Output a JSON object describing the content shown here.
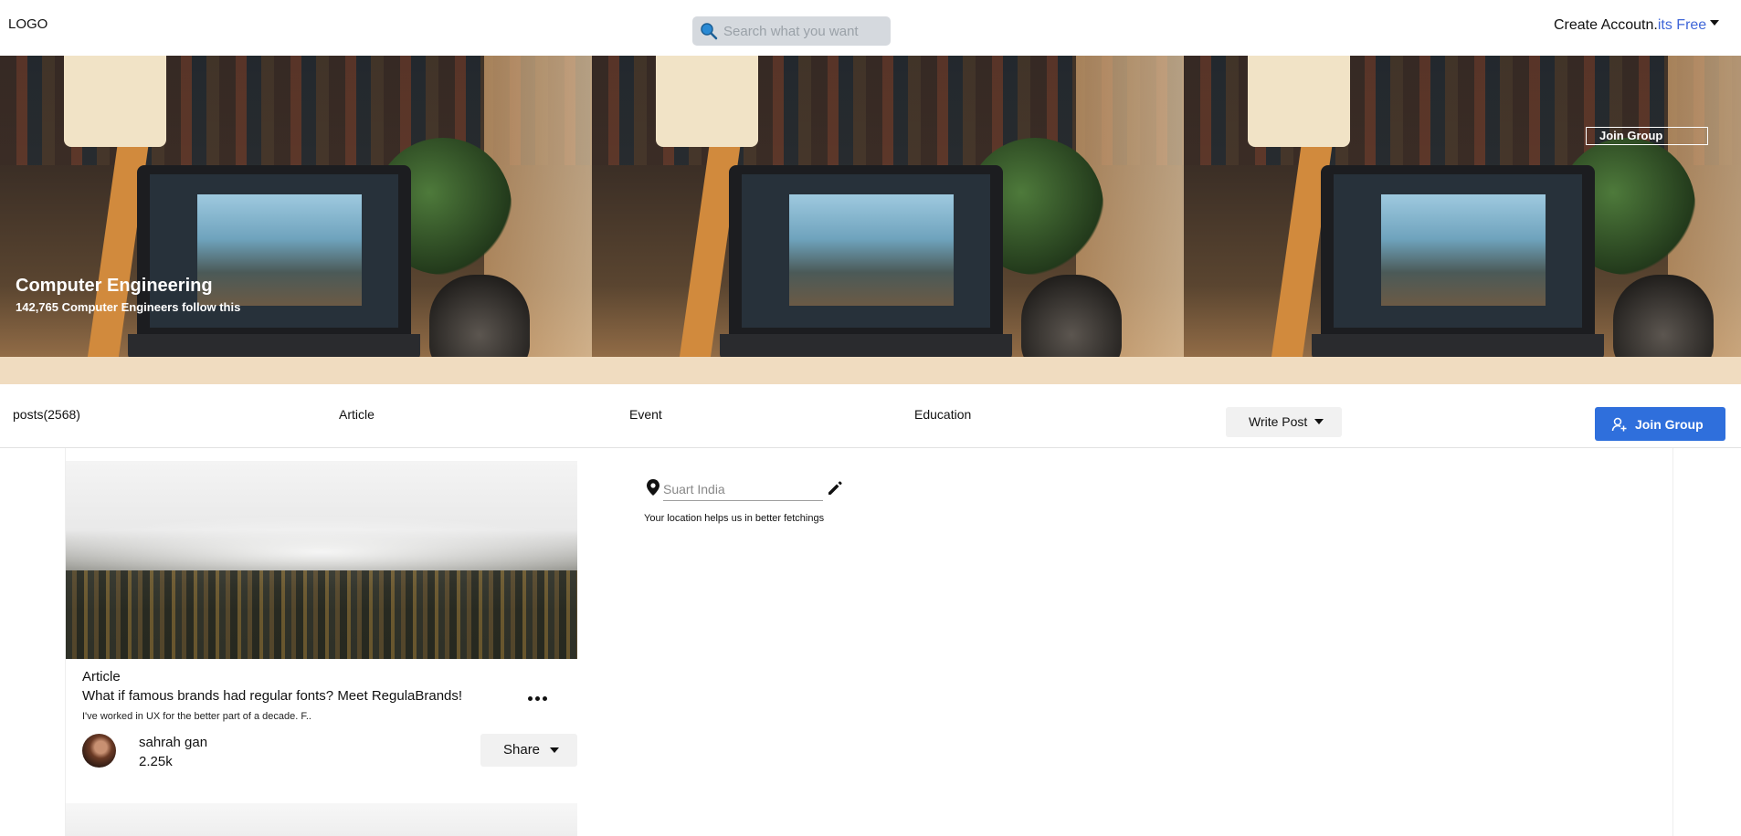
{
  "header": {
    "logo": "LOGO",
    "search_placeholder": "Search what you want",
    "account_text": "Create Accoutn.",
    "account_highlight": "its Free"
  },
  "banner": {
    "title": "Computer Engineering",
    "subtitle": "142,765 Computer Engineers follow this",
    "join_label": "Join Group"
  },
  "nav": {
    "items": [
      "posts(2568)",
      "Article",
      "Event",
      "Education"
    ],
    "write_post_label": "Write Post",
    "join_label": "Join Group"
  },
  "card": {
    "type": "Article",
    "title": "What if famous brands had regular fonts? Meet RegulaBrands!",
    "excerpt": "I've worked in UX for the better part of a decade. F..",
    "author": "sahrah gan",
    "followers": "2.25k",
    "share_label": "Share"
  },
  "location": {
    "placeholder": "Suart India",
    "hint": "Your location helps us in better fetchings"
  },
  "colors": {
    "accent": "#2f6fdc",
    "free_link": "#3f66d8",
    "search_bg": "#d5d9de"
  },
  "icons": [
    "search-icon",
    "chevron-down-icon",
    "add-user-icon",
    "ellipsis-icon",
    "location-pin-icon",
    "pencil-icon"
  ]
}
